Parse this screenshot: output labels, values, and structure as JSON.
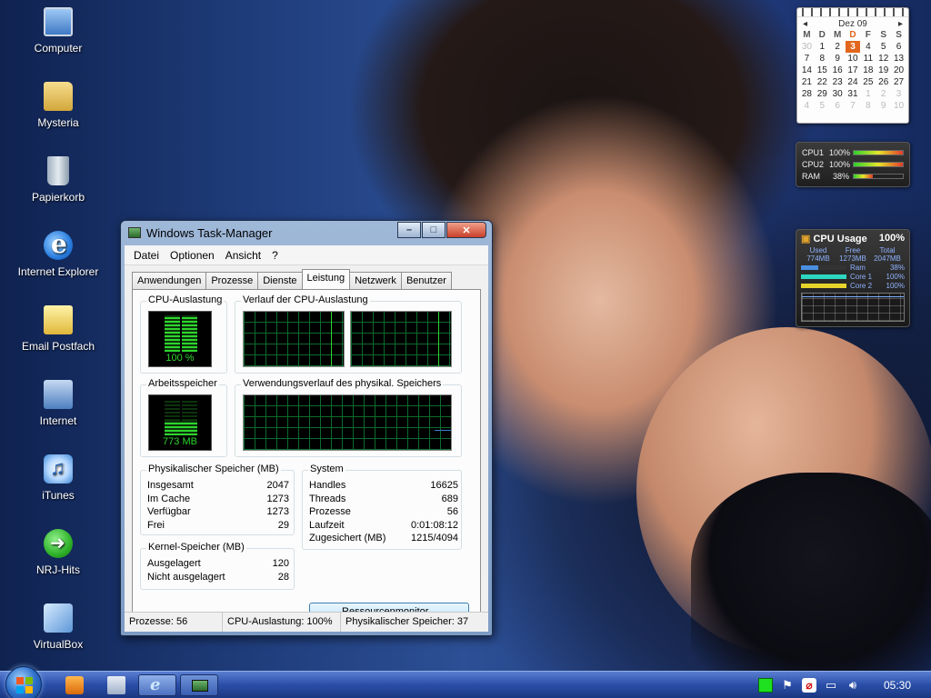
{
  "desktop_icons": [
    {
      "label": "Computer",
      "icon": "computer-icon"
    },
    {
      "label": "Mysteria",
      "icon": "folder-icon"
    },
    {
      "label": "Papierkorb",
      "icon": "recycle-bin-icon"
    },
    {
      "label": "Internet Explorer",
      "icon": "internet-explorer-icon"
    },
    {
      "label": "Email Postfach",
      "icon": "mail-icon"
    },
    {
      "label": "Internet",
      "icon": "internet-icon"
    },
    {
      "label": "iTunes",
      "icon": "itunes-icon"
    },
    {
      "label": "NRJ-Hits",
      "icon": "nrj-icon"
    },
    {
      "label": "VirtualBox",
      "icon": "virtualbox-icon"
    }
  ],
  "calendar": {
    "month": "Dez 09",
    "weekdays": [
      "M",
      "D",
      "M",
      "D",
      "F",
      "S",
      "S"
    ],
    "days": [
      "30",
      "1",
      "2",
      "3",
      "4",
      "5",
      "6",
      "7",
      "8",
      "9",
      "10",
      "11",
      "12",
      "13",
      "14",
      "15",
      "16",
      "17",
      "18",
      "19",
      "20",
      "21",
      "22",
      "23",
      "24",
      "25",
      "26",
      "27",
      "28",
      "29",
      "30",
      "31",
      "1",
      "2",
      "3",
      "4",
      "5",
      "6",
      "7",
      "8",
      "9",
      "10"
    ],
    "today": "3"
  },
  "meter_gadget": {
    "rows": [
      {
        "label": "CPU1",
        "value": "100%",
        "fraction": 1.0
      },
      {
        "label": "CPU2",
        "value": "100%",
        "fraction": 1.0
      },
      {
        "label": "RAM",
        "value": "38%",
        "fraction": 0.38
      }
    ]
  },
  "cpu_gadget": {
    "title": "CPU Usage",
    "value": "100%",
    "cols": [
      {
        "label": "Used",
        "value": "774MB"
      },
      {
        "label": "Free",
        "value": "1273MB"
      },
      {
        "label": "Total",
        "value": "2047MB"
      }
    ],
    "bars": [
      {
        "label": "Ram",
        "value": "38%",
        "fraction": 0.38,
        "color": "#4a8fe0"
      },
      {
        "label": "Core 1",
        "value": "100%",
        "fraction": 1.0,
        "color": "#2dd6c0"
      },
      {
        "label": "Core 2",
        "value": "100%",
        "fraction": 1.0,
        "color": "#e6d42a"
      }
    ]
  },
  "window": {
    "title": "Windows Task-Manager",
    "menu": [
      "Datei",
      "Optionen",
      "Ansicht",
      "?"
    ],
    "tabs": [
      "Anwendungen",
      "Prozesse",
      "Dienste",
      "Leistung",
      "Netzwerk",
      "Benutzer"
    ],
    "active_tab": "Leistung",
    "cpu_group": "CPU-Auslastung",
    "cpu_value": "100 %",
    "cpu_history_group": "Verlauf der CPU-Auslastung",
    "mem_group": "Arbeitsspeicher",
    "mem_value": "773 MB",
    "mem_history_group": "Verwendungsverlauf des physikal. Speichers",
    "phys_group": "Physikalischer Speicher (MB)",
    "phys_rows": [
      {
        "k": "Insgesamt",
        "v": "2047"
      },
      {
        "k": "Im Cache",
        "v": "1273"
      },
      {
        "k": "Verfügbar",
        "v": "1273"
      },
      {
        "k": "Frei",
        "v": "29"
      }
    ],
    "kernel_group": "Kernel-Speicher (MB)",
    "kernel_rows": [
      {
        "k": "Ausgelagert",
        "v": "120"
      },
      {
        "k": "Nicht ausgelagert",
        "v": "28"
      }
    ],
    "system_group": "System",
    "system_rows": [
      {
        "k": "Handles",
        "v": "16625"
      },
      {
        "k": "Threads",
        "v": "689"
      },
      {
        "k": "Prozesse",
        "v": "56"
      },
      {
        "k": "Laufzeit",
        "v": "0:01:08:12"
      },
      {
        "k": "Zugesichert (MB)",
        "v": "1215/4094"
      }
    ],
    "resource_button": "Ressourcenmonitor...",
    "status": {
      "processes": "Prozesse: 56",
      "cpu": "CPU-Auslastung: 100%",
      "memory": "Physikalischer Speicher: 37"
    }
  },
  "taskbar": {
    "clock": "05:30"
  }
}
